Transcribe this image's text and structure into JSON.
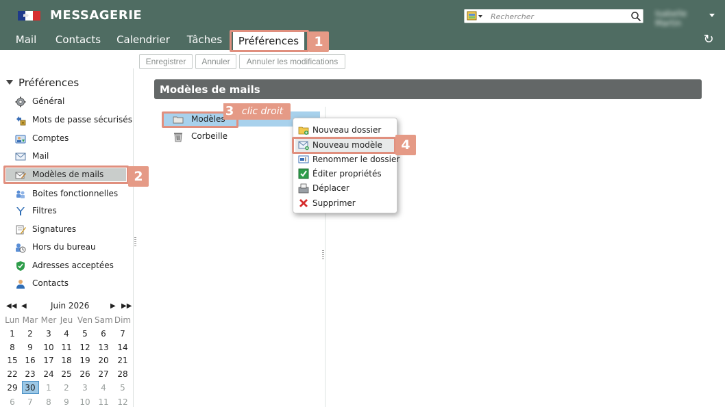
{
  "header": {
    "app_title": "MESSAGERIE",
    "search_placeholder": "Rechercher",
    "user_name": "Isabelle Martin",
    "bg_color": "#4f6c62",
    "refresh_icon": "↻"
  },
  "tabs": [
    {
      "label": "Mail"
    },
    {
      "label": "Contacts"
    },
    {
      "label": "Calendrier"
    },
    {
      "label": "Tâches"
    },
    {
      "label": "Préférences",
      "active": true
    }
  ],
  "toolbar": {
    "save_label": "Enregistrer",
    "cancel_label": "Annuler",
    "discard_label": "Annuler les modifications"
  },
  "sidebar": {
    "title": "Préférences",
    "items": [
      {
        "label": "Général",
        "icon": "gear-icon"
      },
      {
        "label": "Mots de passe sécurisés",
        "icon": "key-icon"
      },
      {
        "label": "Comptes",
        "icon": "account-icon"
      },
      {
        "label": "Mail",
        "icon": "envelope-icon"
      },
      {
        "label": "Modèles de mails",
        "icon": "template-icon",
        "active": true
      },
      {
        "label": "Boites fonctionnelles",
        "icon": "group-icon"
      },
      {
        "label": "Filtres",
        "icon": "filter-icon"
      },
      {
        "label": "Signatures",
        "icon": "signature-icon"
      },
      {
        "label": "Hors du bureau",
        "icon": "clock-icon"
      },
      {
        "label": "Adresses acceptées",
        "icon": "shield-icon"
      },
      {
        "label": "Contacts",
        "icon": "person-icon"
      }
    ]
  },
  "calendar": {
    "month": "Juin 2026",
    "nav_prev_year": "◀◀",
    "nav_prev": "◀",
    "nav_next": "▶",
    "nav_next_year": "▶▶",
    "weekdays": [
      "Lun",
      "Mar",
      "Mer",
      "Jeu",
      "Ven",
      "Sam",
      "Dim"
    ],
    "weeks": [
      [
        "1",
        "2",
        "3",
        "4",
        "5",
        "6",
        "7"
      ],
      [
        "8",
        "9",
        "10",
        "11",
        "12",
        "13",
        "14"
      ],
      [
        "15",
        "16",
        "17",
        "18",
        "19",
        "20",
        "21"
      ],
      [
        "22",
        "23",
        "24",
        "25",
        "26",
        "27",
        "28"
      ],
      [
        "29",
        "30",
        "1",
        "2",
        "3",
        "4",
        "5"
      ],
      [
        "6",
        "7",
        "8",
        "9",
        "10",
        "11",
        "12"
      ]
    ],
    "selected": "30"
  },
  "main": {
    "title": "Modèles de mails",
    "tree": [
      {
        "label": "Modèles",
        "icon": "folder-icon",
        "selected": true
      },
      {
        "label": "Corbeille",
        "icon": "trash-icon"
      }
    ]
  },
  "context_menu": {
    "items": [
      {
        "label": "Nouveau dossier",
        "icon": "new-folder-icon"
      },
      {
        "label": "Nouveau modèle",
        "icon": "new-template-icon",
        "highlighted": true
      },
      {
        "label": "Renommer le dossier",
        "icon": "rename-icon"
      },
      {
        "label": "Éditer propriétés",
        "icon": "edit-properties-icon"
      },
      {
        "label": "Déplacer",
        "icon": "move-icon"
      },
      {
        "label": "Supprimer",
        "icon": "delete-icon"
      }
    ]
  },
  "callouts": {
    "step1": "1",
    "step2": "2",
    "step3": "3",
    "step3_text": "clic droit",
    "step4": "4",
    "color": "#e59a86"
  }
}
